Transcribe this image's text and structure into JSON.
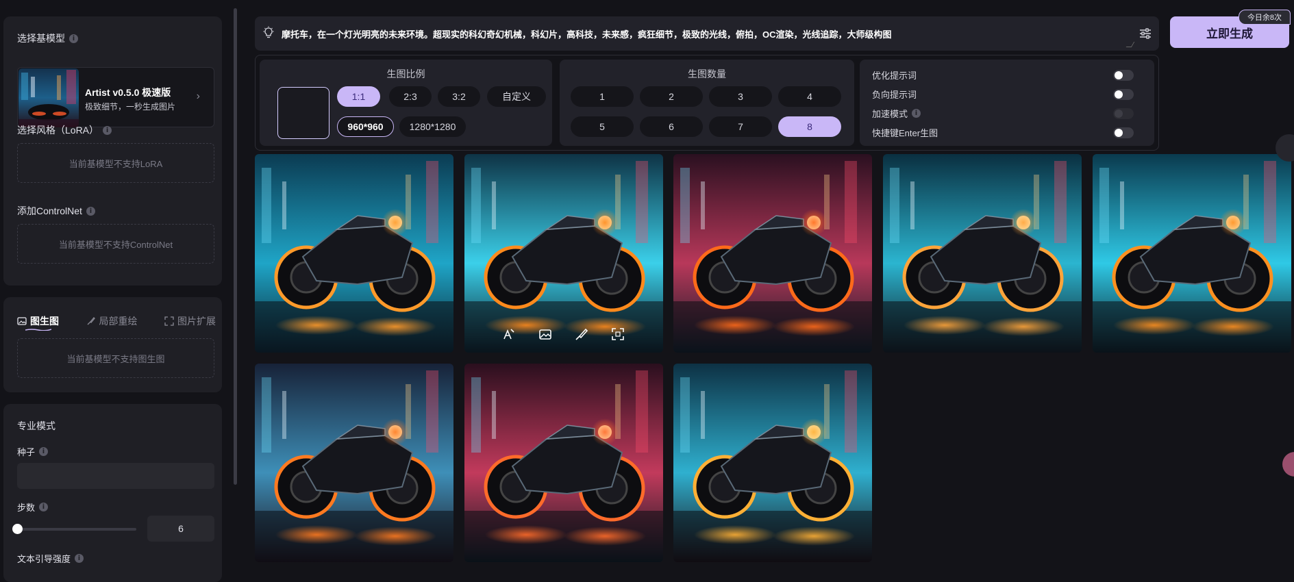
{
  "sidebar": {
    "base_model": {
      "title": "选择基模型",
      "name": "Artist v0.5.0 极速版",
      "desc": "极致细节，一秒生成图片"
    },
    "lora": {
      "title": "选择风格（LoRA）",
      "empty": "当前基模型不支持LoRA"
    },
    "controlnet": {
      "title": "添加ControlNet",
      "empty": "当前基模型不支持ControlNet"
    },
    "tabs": [
      {
        "label": "图生图",
        "icon": "image-icon",
        "active": true
      },
      {
        "label": "局部重绘",
        "icon": "brush-icon",
        "active": false
      },
      {
        "label": "图片扩展",
        "icon": "expand-icon",
        "active": false
      }
    ],
    "img2img_empty": "当前基模型不支持图生图",
    "pro_mode": {
      "title": "专业模式",
      "seed_label": "种子",
      "seed_value": "",
      "steps_label": "步数",
      "steps_value": "6",
      "steps_fraction": 0.0,
      "next_label": "文本引导强度"
    }
  },
  "prompt": {
    "text": "摩托车，在一个灯光明亮的未来环境。超现实的科幻奇幻机械，科幻片，高科技，未来感，疯狂细节，极致的光线，俯拍，OC渲染，光线追踪，大师级构图"
  },
  "generate": {
    "label": "立即生成",
    "badge": "今日余8次"
  },
  "settings": {
    "ratio": {
      "title": "生图比例",
      "options": [
        "1:1",
        "2:3",
        "3:2",
        "自定义"
      ],
      "selected": "1:1",
      "sizes": [
        "960*960",
        "1280*1280"
      ],
      "selected_size": "960*960"
    },
    "count": {
      "title": "生图数量",
      "options": [
        "1",
        "2",
        "3",
        "4",
        "5",
        "6",
        "7",
        "8"
      ],
      "selected": "8"
    },
    "toggles": [
      {
        "label": "优化提示词",
        "on": false,
        "info": false,
        "disabled": false
      },
      {
        "label": "负向提示词",
        "on": false,
        "info": false,
        "disabled": false
      },
      {
        "label": "加速模式",
        "on": false,
        "info": true,
        "disabled": true
      },
      {
        "label": "快捷键Enter生图",
        "on": false,
        "info": false,
        "disabled": false
      }
    ]
  },
  "gallery": {
    "count": 8,
    "hovered_index": 1,
    "hover_actions": [
      "sketch-icon",
      "image-icon",
      "brush-icon",
      "expand-icon"
    ]
  },
  "colors": {
    "accent": "#c9b7f7",
    "bg": "#131318",
    "panel": "#1f1f25"
  }
}
